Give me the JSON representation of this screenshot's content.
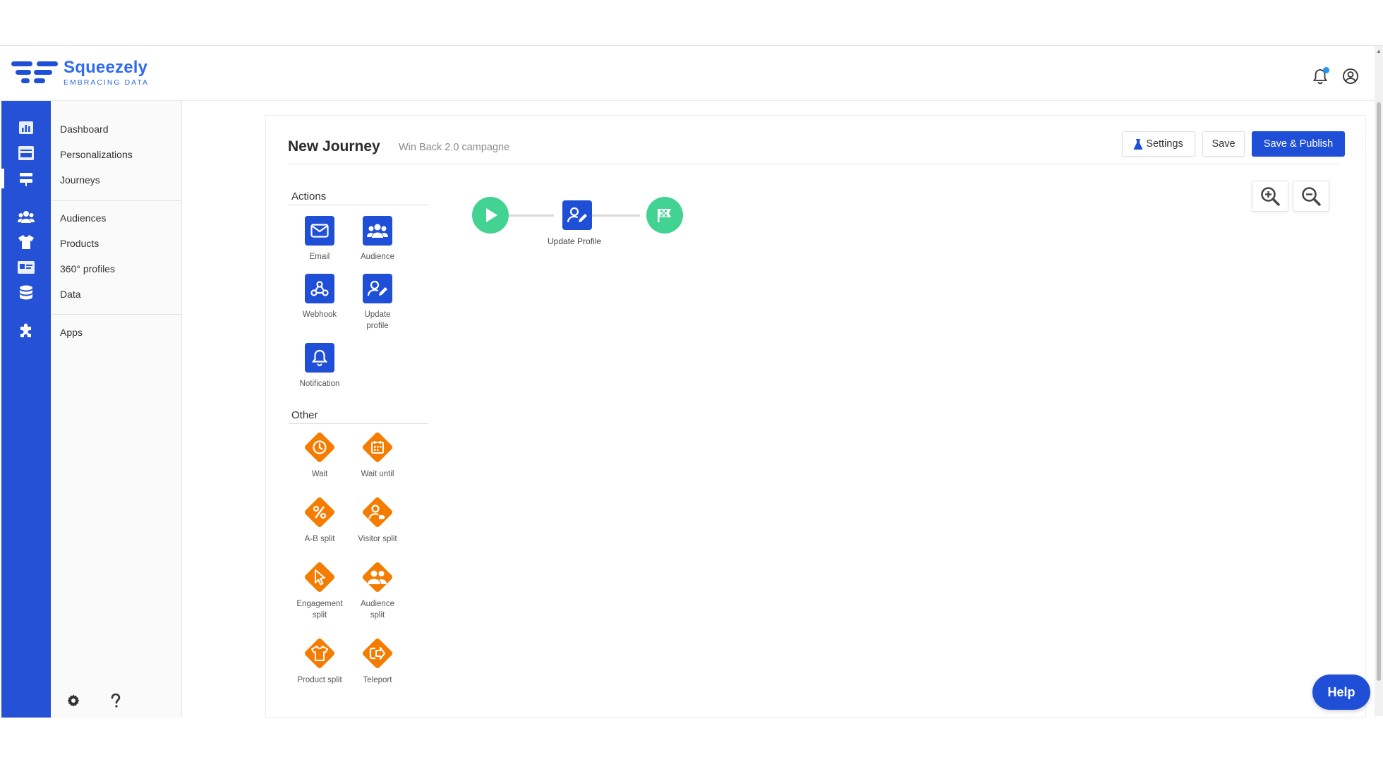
{
  "brand": {
    "name": "Squeezely",
    "tagline": "EMBRACING DATA"
  },
  "subnav": {
    "group1": [
      "Dashboard",
      "Personalizations",
      "Journeys"
    ],
    "group2": [
      "Audiences",
      "Products",
      "360° profiles",
      "Data"
    ],
    "group3": [
      "Apps"
    ],
    "active": "Journeys"
  },
  "page": {
    "title": "New Journey",
    "subtitle": "Win Back 2.0 campagne"
  },
  "toolbar": {
    "settings_label": "Settings",
    "save_label": "Save",
    "publish_label": "Save & Publish"
  },
  "palette": {
    "actions_label": "Actions",
    "actions": [
      "Email",
      "Audience",
      "Webhook",
      "Update profile",
      "Notification"
    ],
    "other_label": "Other",
    "other": [
      "Wait",
      "Wait until",
      "A-B split",
      "Visitor split",
      "Engagement split",
      "Audience split",
      "Product split",
      "Teleport"
    ]
  },
  "flow": {
    "node_label": "Update Profile"
  },
  "help_label": "Help",
  "colors": {
    "primary": "#1f4fd6",
    "accent_green": "#42d392",
    "accent_orange": "#f57c00"
  }
}
